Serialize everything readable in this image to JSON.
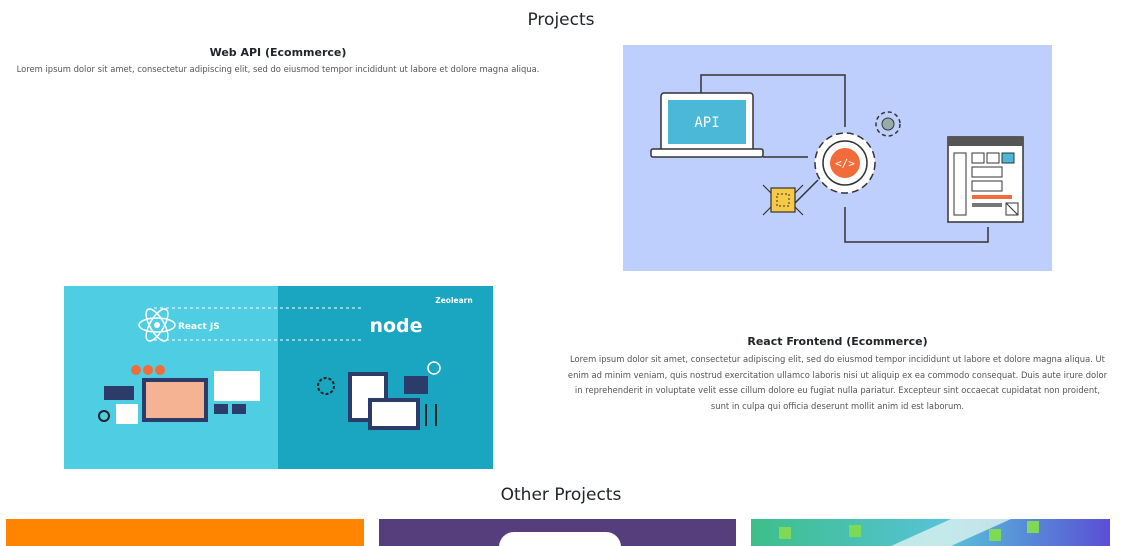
{
  "projects": {
    "heading": "Projects",
    "items": [
      {
        "title": "Web API (Ecommerce)",
        "description": "Lorem ipsum dolor sit amet, consectetur adipiscing elit, sed do eiusmod tempor incididunt ut labore et dolore magna aliqua.",
        "image_label": "API",
        "image_bg": "#bfcffd"
      },
      {
        "title": "React Frontend (Ecommerce)",
        "description": "Lorem ipsum dolor sit amet, consectetur adipiscing elit, sed do eiusmod tempor incididunt ut labore et dolore magna aliqua. Ut enim ad minim veniam, quis nostrud exercitation ullamco laboris nisi ut aliquip ex ea commodo consequat. Duis aute irure dolor in reprehenderit in voluptate velit esse cillum dolore eu fugiat nulla pariatur. Excepteur sint occaecat cupidatat non proident, sunt in culpa qui officia deserunt mollit anim id est laborum.",
        "image_left_label": "React JS",
        "image_right_label": "node",
        "image_brand": "Zeolearn",
        "image_bg_left": "#4fcde2",
        "image_bg_right": "#1aa6c1"
      }
    ]
  },
  "other_projects": {
    "heading": "Other Projects",
    "cards": [
      {
        "color": "#ff8400"
      },
      {
        "color": "#563d7c"
      },
      {
        "color": "#3dbf8a"
      }
    ]
  }
}
